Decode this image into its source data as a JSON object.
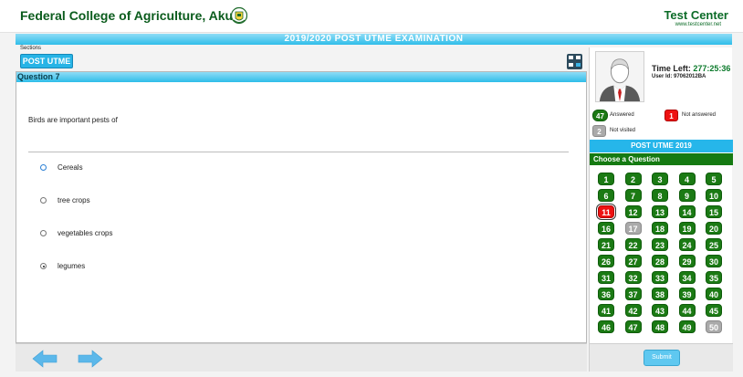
{
  "header": {
    "college_title": "Federal College of Agriculture, Akure",
    "test_center_title": "Test Center",
    "test_center_url": "www.testcenter.net"
  },
  "exam": {
    "title": "2019/2020 POST UTME EXAMINATION",
    "sections_label": "Sections",
    "section_tab": "POST UTME"
  },
  "question": {
    "header": "Question 7",
    "text": "Birds are important pests of",
    "options": [
      {
        "label": "Cereals",
        "selected": false
      },
      {
        "label": "tree crops",
        "selected": false
      },
      {
        "label": "vegetables crops",
        "selected": false
      },
      {
        "label": "legumes",
        "selected": true
      }
    ]
  },
  "candidate": {
    "time_left_label": "Time Left:",
    "time_left_value": "277:25:36",
    "user_id": "User Id: 97062012BA"
  },
  "legend": {
    "answered_count": "47",
    "answered_label": "Answered",
    "not_answered_count": "1",
    "not_answered_label": "Not answered",
    "not_visited_count": "2",
    "not_visited_label": "Not visited"
  },
  "palette": {
    "section_title": "POST UTME 2019",
    "choose_label": "Choose a Question",
    "current_question": 11,
    "not_answered": [
      11
    ],
    "not_visited": [
      17,
      50
    ],
    "total": 50
  },
  "submit_label": "Submit",
  "colors": {
    "brand_green": "#0b5c1d",
    "accent_blue": "#26b6ea",
    "answered": "#1b7a14",
    "not_answered": "#ee1111",
    "not_visited": "#aaaaaa"
  }
}
